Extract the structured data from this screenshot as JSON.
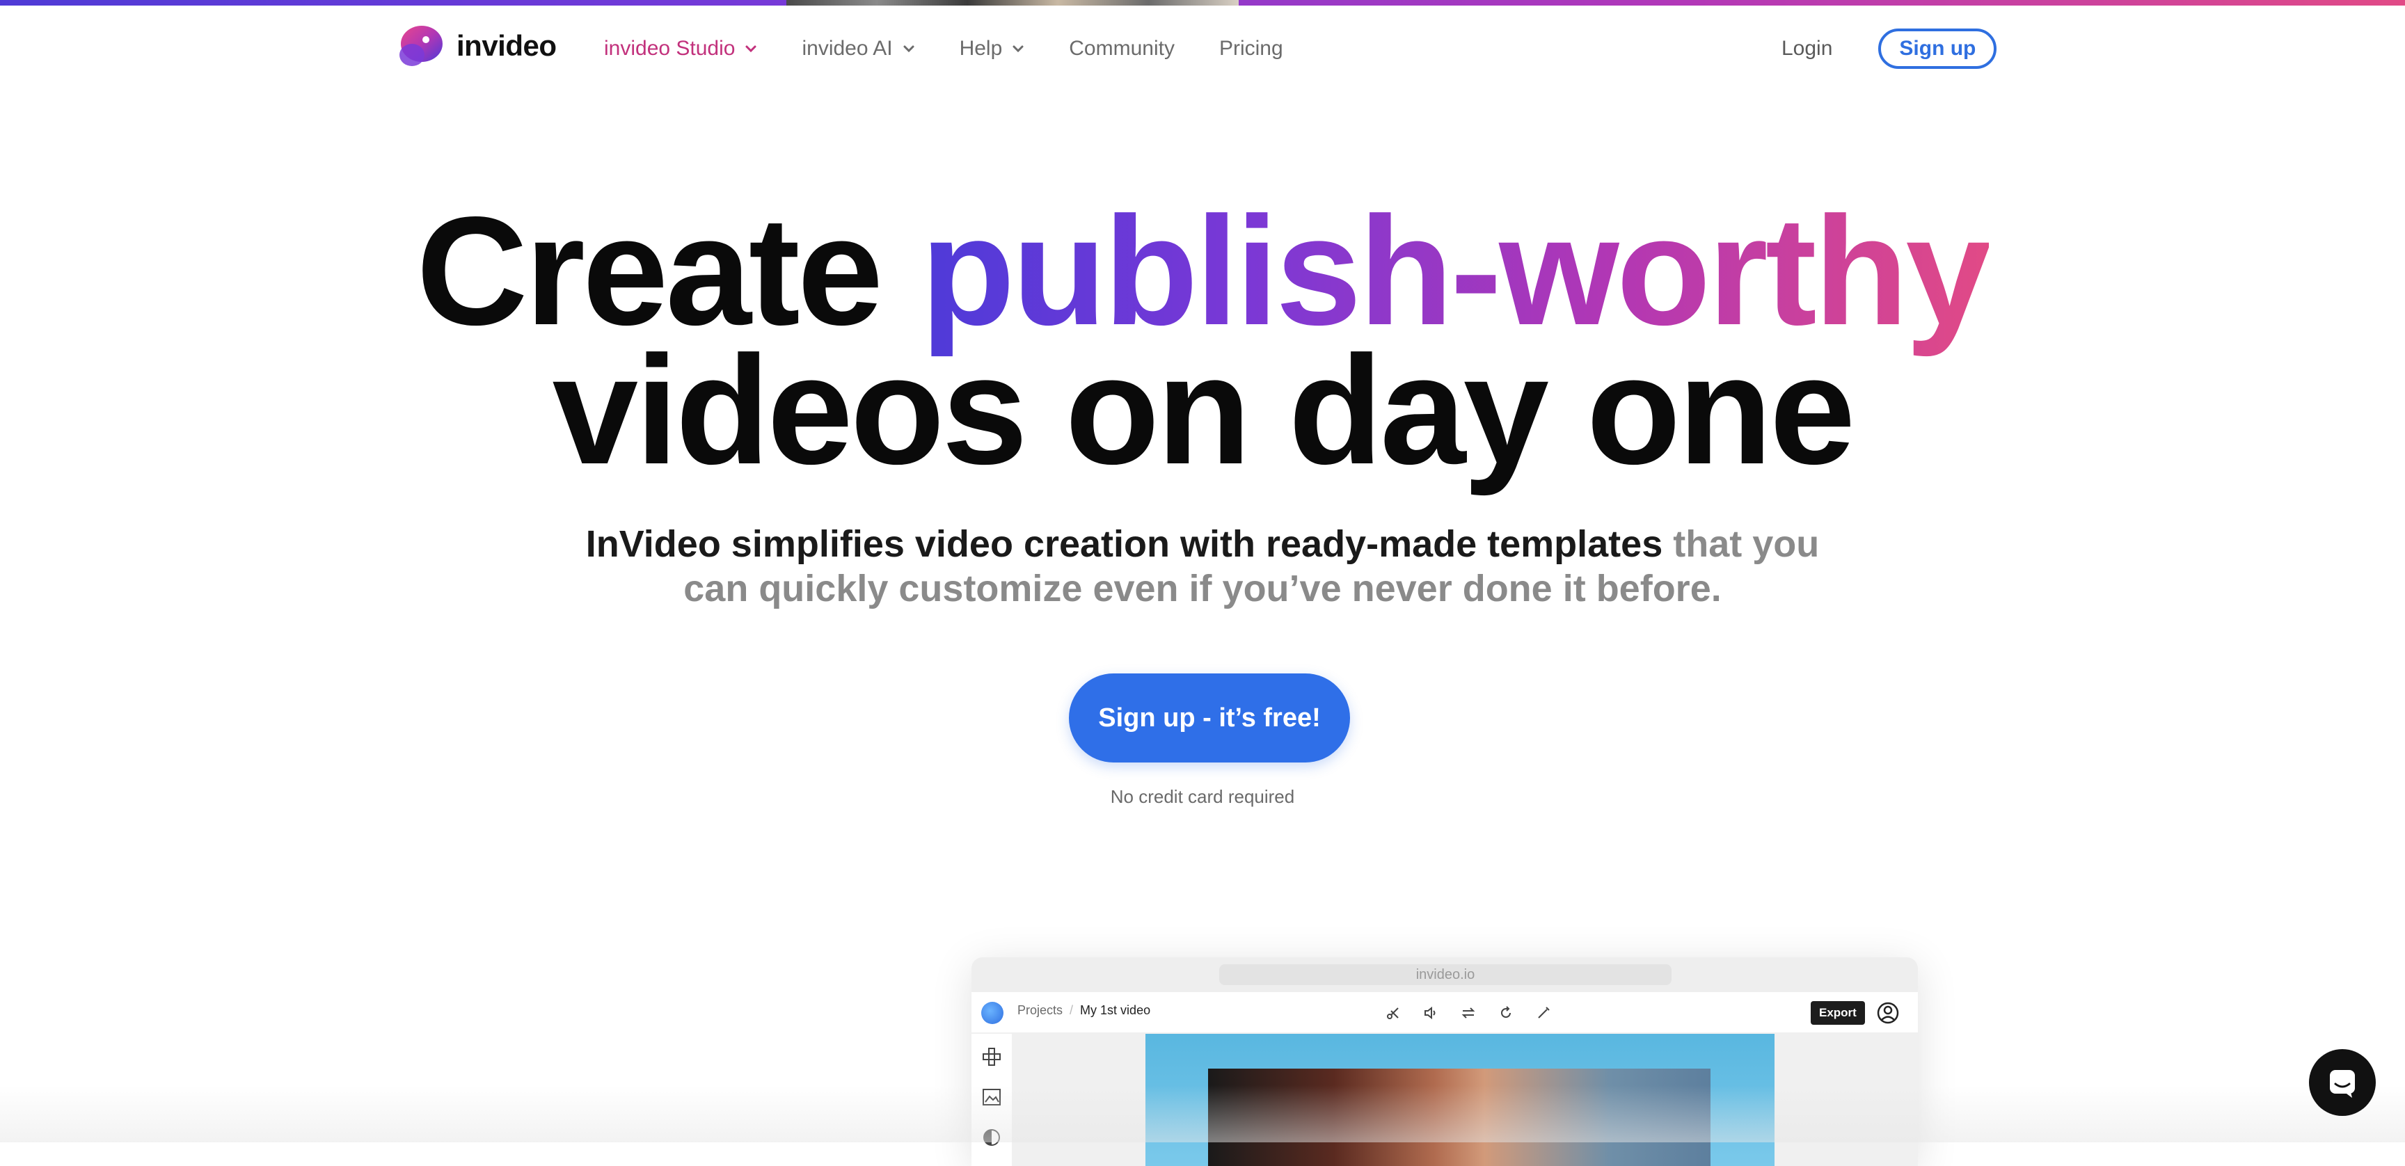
{
  "brand": {
    "name": "invideo",
    "accent": "#c2317c",
    "primary_blue": "#2f6fe8"
  },
  "nav": {
    "items": [
      {
        "label": "invideo Studio",
        "dropdown": true,
        "active": true
      },
      {
        "label": "invideo AI",
        "dropdown": true,
        "active": false
      },
      {
        "label": "Help",
        "dropdown": true,
        "active": false
      },
      {
        "label": "Community",
        "dropdown": false,
        "active": false
      },
      {
        "label": "Pricing",
        "dropdown": false,
        "active": false
      }
    ],
    "login_label": "Login",
    "signup_label": "Sign up"
  },
  "hero": {
    "title_line1_plain": "Create ",
    "title_line1_gradient": "publish-worthy",
    "title_line2": "videos on day one",
    "subtitle_dark": "InVideo simplifies video creation with ready-made templates",
    "subtitle_light": " that you can quickly customize even if you’ve never done it before.",
    "cta_label": "Sign up - it’s free!",
    "note": "No credit card required"
  },
  "preview": {
    "url": "invideo.io",
    "breadcrumb_root": "Projects",
    "breadcrumb_sep": "/",
    "breadcrumb_current": "My 1st video",
    "export_label": "Export",
    "tools": [
      "scissors-icon",
      "volume-icon",
      "swap-icon",
      "rotate-icon",
      "magic-wand-icon"
    ],
    "sidebar_icons": [
      "elements-icon",
      "media-icon",
      "filters-icon"
    ]
  },
  "chat": {
    "icon": "chat-icon"
  }
}
